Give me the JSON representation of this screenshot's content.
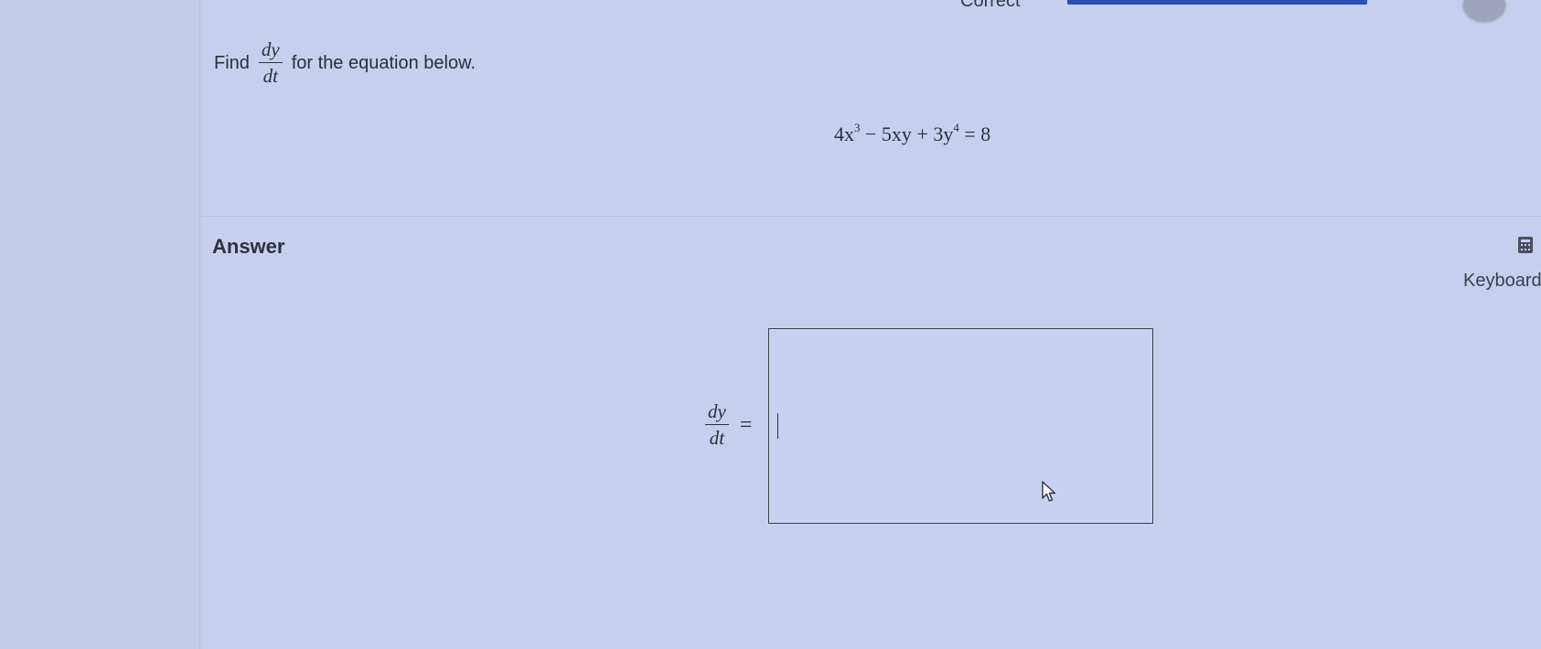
{
  "header": {
    "status_text": "Correct"
  },
  "question": {
    "prefix": "Find",
    "fraction_numerator": "dy",
    "fraction_denominator": "dt",
    "suffix": "for the equation below.",
    "equation": {
      "t1_coef": "4x",
      "t1_exp": "3",
      "t2": " − 5xy + 3y",
      "t3_exp": "4",
      "t4": " = 8"
    }
  },
  "answer": {
    "heading": "Answer",
    "lhs_numerator": "dy",
    "lhs_denominator": "dt",
    "equals": "=",
    "input_value": ""
  },
  "keyboard": {
    "label": "Keyboard",
    "icon": "calculator-icon"
  },
  "colors": {
    "background": "#c3cdea",
    "progress_bar": "#2a4fb1",
    "text": "#2a2e3c"
  }
}
